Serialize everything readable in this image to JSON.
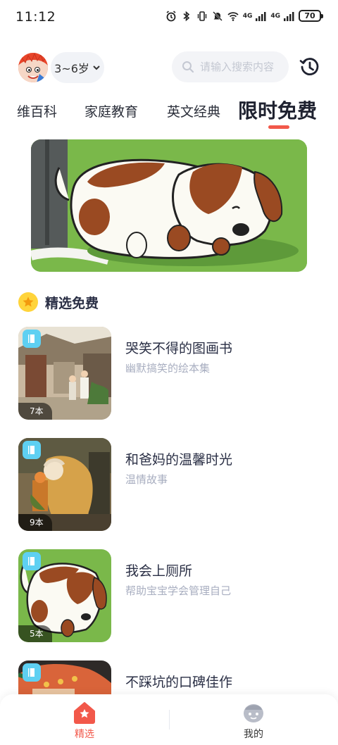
{
  "status_bar": {
    "time": "11:12",
    "network_1": "4G",
    "network_2": "4G",
    "battery": "70"
  },
  "header": {
    "age_selector": "3~6岁",
    "search_placeholder": "请输入搜索内容"
  },
  "tabs": [
    {
      "label": "维百科"
    },
    {
      "label": "家庭教育"
    },
    {
      "label": "英文经典"
    },
    {
      "label": "限时免费",
      "active": true
    }
  ],
  "section": {
    "title": "精选免费"
  },
  "items": [
    {
      "title": "哭笑不得的图画书",
      "subtitle": "幽默搞笑的绘本集",
      "count": "7本"
    },
    {
      "title": "和爸妈的温馨时光",
      "subtitle": "温情故事",
      "count": "9本"
    },
    {
      "title": "我会上厕所",
      "subtitle": "帮助宝宝学会管理自己",
      "count": "5本"
    },
    {
      "title": "不踩坑的口碑佳作",
      "subtitle": "",
      "count": ""
    }
  ],
  "bottom_nav": {
    "home_label": "精选",
    "mine_label": "我的"
  },
  "colors": {
    "accent": "#f2584a",
    "active_nav": "#f2584a",
    "tag_blue": "#5ed0f2",
    "star_yellow": "#ffd43b"
  },
  "icons": [
    "alarm-icon",
    "bluetooth-icon",
    "vibrate-icon",
    "mute-icon",
    "wifi-icon",
    "signal-icon",
    "battery-icon",
    "chevron-down-icon",
    "search-icon",
    "history-icon",
    "star-icon",
    "book-tag-icon",
    "home-icon",
    "profile-icon"
  ]
}
